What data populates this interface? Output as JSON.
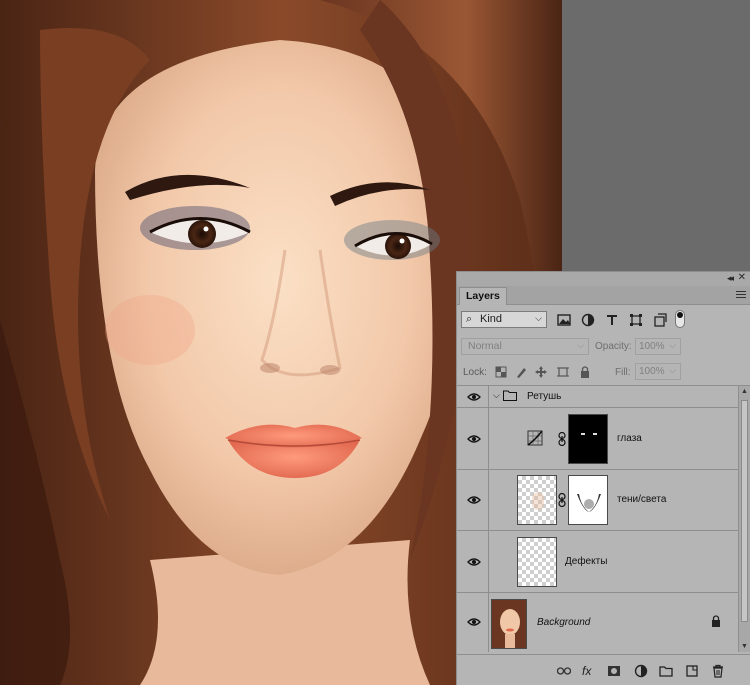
{
  "colors": {
    "panel_bg": "#b5b5b5",
    "workspace_bg": "#6b6b6b",
    "mask_black": "#000000"
  },
  "layers_panel": {
    "tab_label": "Layers",
    "filter": {
      "kind_label": "Kind"
    },
    "blend": {
      "mode": "Normal",
      "opacity_label": "Opacity:",
      "opacity_value": "100%",
      "fill_label": "Fill:",
      "fill_value": "100%",
      "lock_label": "Lock:"
    },
    "layers": [
      {
        "name": "Ретушь",
        "type": "group",
        "visible": true,
        "expanded": true
      },
      {
        "name": "глаза",
        "type": "adjustment",
        "visible": true,
        "mask": "black-with-eye-highlights"
      },
      {
        "name": "тени/света",
        "type": "pixel-with-mask",
        "visible": true,
        "mask": "white-with-shadows"
      },
      {
        "name": "Дефекты",
        "type": "pixel",
        "visible": true
      },
      {
        "name": "Background",
        "type": "background",
        "visible": true,
        "locked": true
      }
    ],
    "bottom_icons": [
      "link-icon",
      "fx-icon",
      "mask-icon",
      "adjustment-icon",
      "folder-icon",
      "new-layer-icon",
      "trash-icon"
    ],
    "bottom_fx_label": "fx"
  }
}
